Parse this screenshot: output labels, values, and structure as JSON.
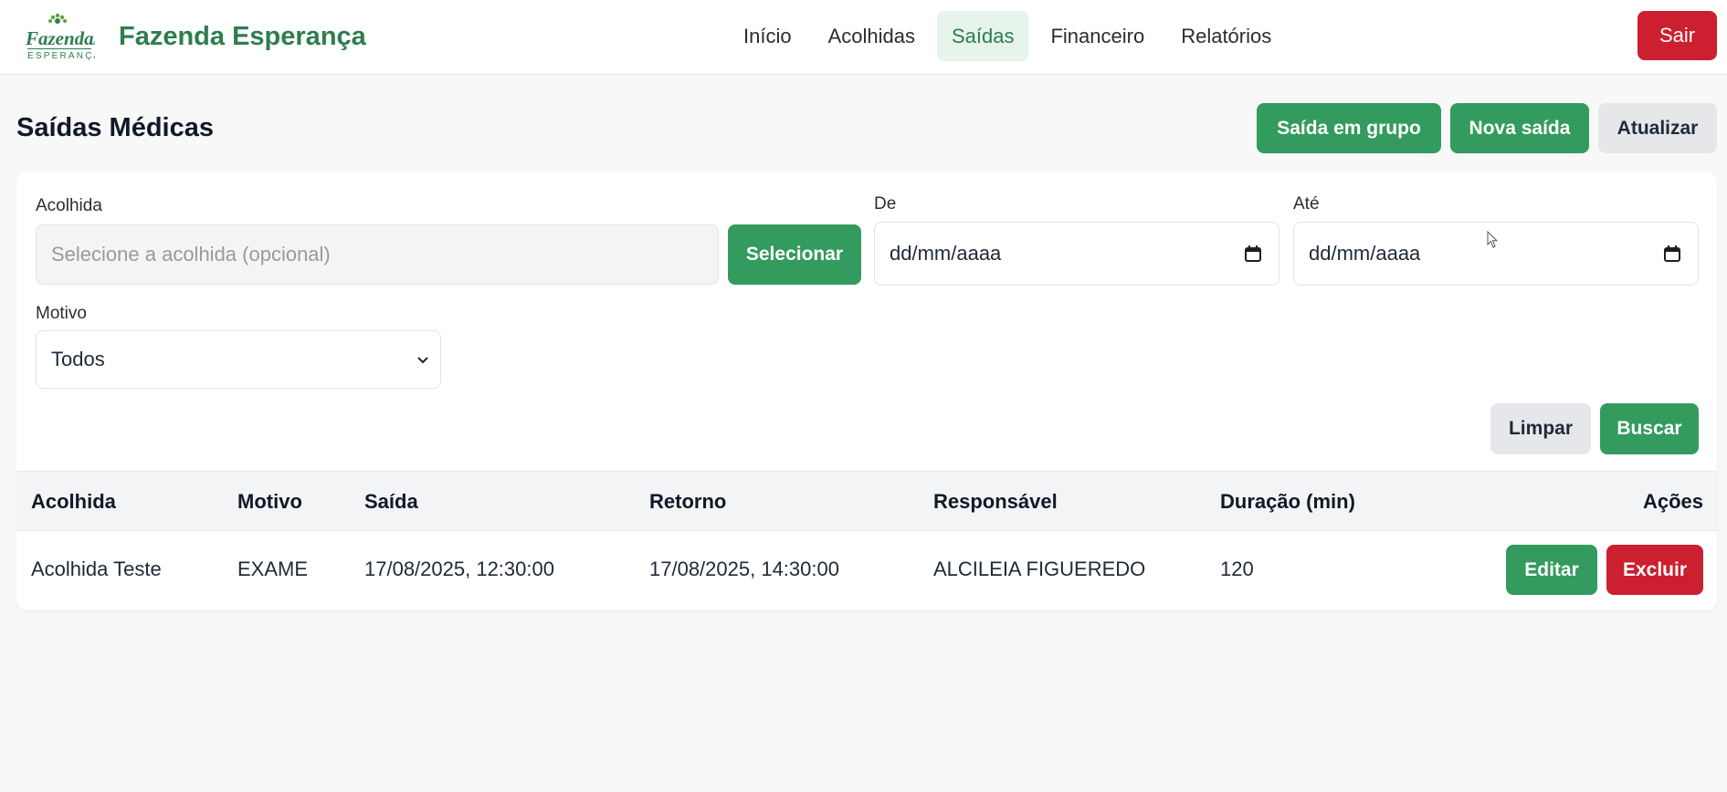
{
  "header": {
    "logo_text": "Fazenda Esperança",
    "brand": "Fazenda Esperança",
    "nav": [
      {
        "label": "Início",
        "active": false
      },
      {
        "label": "Acolhidas",
        "active": false
      },
      {
        "label": "Saídas",
        "active": true
      },
      {
        "label": "Financeiro",
        "active": false
      },
      {
        "label": "Relatórios",
        "active": false
      }
    ],
    "logout_label": "Sair"
  },
  "page": {
    "title": "Saídas Médicas",
    "actions": {
      "group_exit": "Saída em grupo",
      "new_exit": "Nova saída",
      "refresh": "Atualizar"
    }
  },
  "filters": {
    "acolhida_label": "Acolhida",
    "acolhida_placeholder": "Selecione a acolhida (opcional)",
    "select_button": "Selecionar",
    "from_label": "De",
    "from_value": "dd/mm/aaaa",
    "to_label": "Até",
    "to_value": "dd/mm/aaaa",
    "reason_label": "Motivo",
    "reason_selected": "Todos",
    "clear_button": "Limpar",
    "search_button": "Buscar"
  },
  "table": {
    "columns": [
      "Acolhida",
      "Motivo",
      "Saída",
      "Retorno",
      "Responsável",
      "Duração (min)",
      "Ações"
    ],
    "rows": [
      {
        "acolhida": "Acolhida Teste",
        "motivo": "EXAME",
        "saida": "17/08/2025, 12:30:00",
        "retorno": "17/08/2025, 14:30:00",
        "responsavel": "ALCILEIA FIGUEREDO",
        "duracao": "120",
        "edit_label": "Editar",
        "delete_label": "Excluir"
      }
    ]
  },
  "colors": {
    "brand_green": "#2e7d4f",
    "button_green": "#339b5e",
    "danger_red": "#cc1f2f",
    "nav_active_bg": "#e6f4ea"
  },
  "icons": {
    "date_picker": "calendar-icon",
    "select": "chevron-down-icon",
    "logo": "fazenda-logo"
  }
}
